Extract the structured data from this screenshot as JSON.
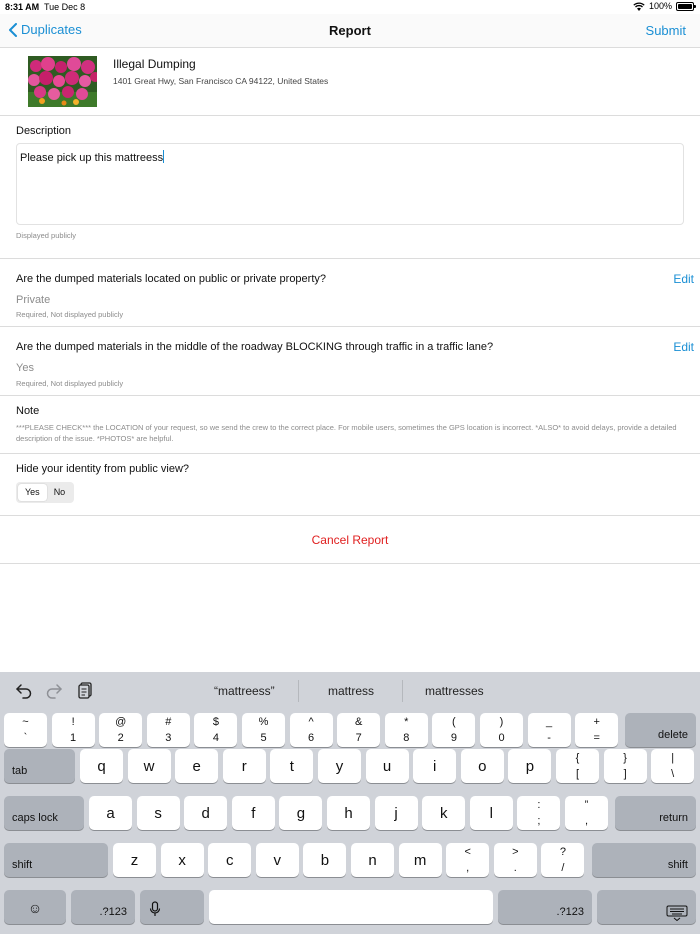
{
  "status": {
    "time": "8:31 AM",
    "date": "Tue Dec 8",
    "battery": "100%"
  },
  "nav": {
    "back_label": "Duplicates",
    "title": "Report",
    "submit_label": "Submit"
  },
  "report": {
    "title": "Illegal Dumping",
    "address": "1401 Great Hwy, San Francisco CA 94122, United States"
  },
  "description": {
    "label": "Description",
    "value": "Please pick up this mattreess",
    "hint": "Displayed publicly"
  },
  "q1": {
    "question": "Are the dumped materials located on public or private property?",
    "answer": "Private",
    "hint": "Required, Not displayed publicly",
    "edit_label": "Edit"
  },
  "q2": {
    "question": "Are the dumped materials in the middle of the roadway BLOCKING through traffic in a traffic lane?",
    "answer": "Yes",
    "hint": "Required, Not displayed publicly",
    "edit_label": "Edit"
  },
  "note": {
    "label": "Note",
    "text": "***PLEASE CHECK*** the LOCATION of your request, so we send the crew to the correct place. For mobile users, sometimes the GPS location is incorrect. *ALSO* to avoid delays, provide a detailed description of the issue. *PHOTOS* are helpful."
  },
  "identity": {
    "question": "Hide your identity from public view?",
    "yes": "Yes",
    "no": "No",
    "selected": "Yes"
  },
  "cancel_label": "Cancel Report",
  "keyboard": {
    "suggestions": [
      "“mattreess”",
      "mattress",
      "mattresses"
    ],
    "tools": [
      "undo-icon",
      "redo-icon",
      "clipboard-icon"
    ],
    "row1": [
      {
        "top": "~",
        "bot": "`"
      },
      {
        "top": "!",
        "bot": "1"
      },
      {
        "top": "@",
        "bot": "2"
      },
      {
        "top": "#",
        "bot": "3"
      },
      {
        "top": "$",
        "bot": "4"
      },
      {
        "top": "%",
        "bot": "5"
      },
      {
        "top": "^",
        "bot": "6"
      },
      {
        "top": "&",
        "bot": "7"
      },
      {
        "top": "*",
        "bot": "8"
      },
      {
        "top": "(",
        "bot": "9"
      },
      {
        "top": ")",
        "bot": "0"
      },
      {
        "top": "_",
        "bot": "-"
      },
      {
        "top": "+",
        "bot": "="
      }
    ],
    "delete": "delete",
    "tab": "tab",
    "row2": [
      "q",
      "w",
      "e",
      "r",
      "t",
      "y",
      "u",
      "i",
      "o",
      "p"
    ],
    "row2_extra": [
      {
        "top": "{",
        "bot": "["
      },
      {
        "top": "}",
        "bot": "]"
      },
      {
        "top": "|",
        "bot": "\\"
      }
    ],
    "caps": "caps lock",
    "row3": [
      "a",
      "s",
      "d",
      "f",
      "g",
      "h",
      "j",
      "k",
      "l"
    ],
    "row3_extra": [
      {
        "top": ":",
        "bot": ";"
      },
      {
        "top": "”",
        "bot": ","
      }
    ],
    "return": "return",
    "shift": "shift",
    "row4": [
      "z",
      "x",
      "c",
      "v",
      "b",
      "n",
      "m"
    ],
    "row4_extra": [
      {
        "top": "<",
        "bot": ","
      },
      {
        "top": ">",
        "bot": "."
      },
      {
        "top": "?",
        "bot": "/"
      }
    ],
    "num_label": ".?123",
    "emoji_icon": "emoji-icon",
    "mic_icon": "microphone-icon",
    "hide_icon": "keyboard-hide-icon"
  }
}
